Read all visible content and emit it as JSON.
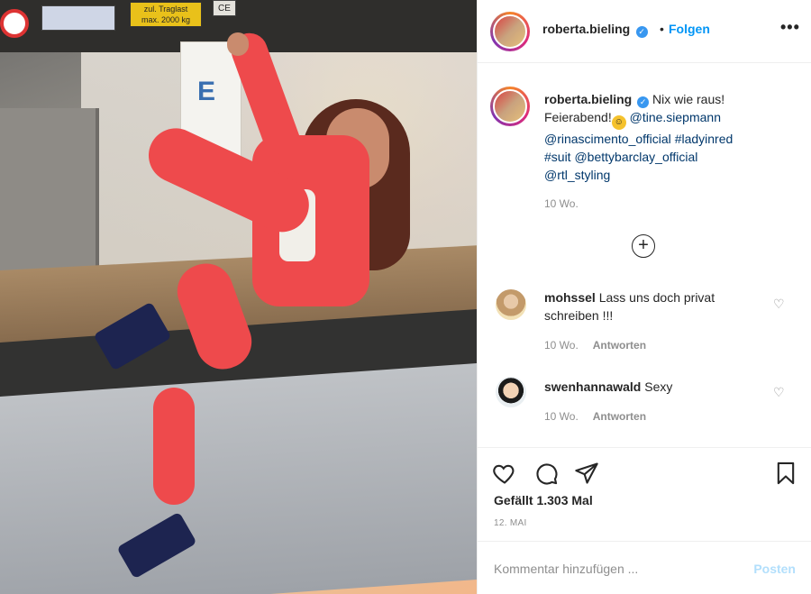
{
  "photo": {
    "sign_capacity_line1": "zul. Traglast",
    "sign_capacity_line2": "max. 2000 kg",
    "sign_ce": "CE",
    "poster_letter": "E"
  },
  "header": {
    "username": "roberta.bieling",
    "separator": "•",
    "follow_label": "Folgen",
    "more_label": "•••"
  },
  "caption": {
    "username": "roberta.bieling",
    "text_1": "Nix wie raus!",
    "text_2": "Feierabend!",
    "mention_1": "@tine.siepmann",
    "mention_2": "@rinascimento_official",
    "hashtag_1": "#ladyinred",
    "hashtag_2": "#suit",
    "mention_3": "@bettybarclay_official",
    "mention_4": "@rtl_styling",
    "time": "10 Wo."
  },
  "load_more_icon": "plus-circle-icon",
  "comments": [
    {
      "username": "mohssel",
      "text": "Lass uns doch privat schreiben !!!",
      "time": "10 Wo.",
      "reply_label": "Antworten"
    },
    {
      "username": "swenhannawald",
      "text": "Sexy",
      "time": "10 Wo.",
      "reply_label": "Antworten"
    }
  ],
  "actions": {
    "icons": [
      "heart-icon",
      "comment-icon",
      "share-icon",
      "bookmark-icon"
    ],
    "likes": "Gefällt 1.303 Mal",
    "date": "12. MAI"
  },
  "comment_box": {
    "placeholder": "Kommentar hinzufügen ...",
    "post_label": "Posten"
  },
  "colors": {
    "link": "#0095f6",
    "tag": "#00376b",
    "muted": "#8e8e8e",
    "post_disabled": "#b2dffc",
    "verified": "#3897f0"
  }
}
